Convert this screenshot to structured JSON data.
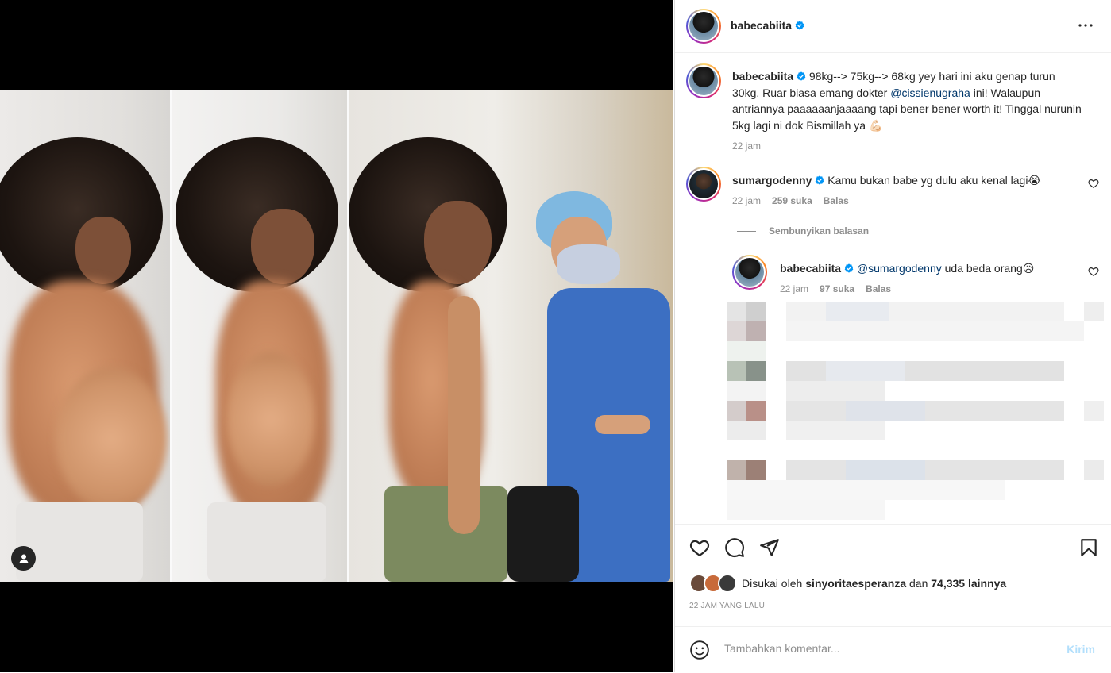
{
  "post": {
    "author": "babecabiita",
    "caption_text": "98kg--> 75kg--> 68kg yey hari ini aku genap turun 30kg. Ruar biasa emang dokter ",
    "caption_mention": "@cissienugraha",
    "caption_end": " ini! Walaupun antriannya paaaaaanjaaaang tapi bener bener worth it! Tinggal nurunin 5kg lagi ni dok Bismillah ya 💪🏻",
    "caption_time": "22 jam"
  },
  "comments": [
    {
      "user": "sumargodenny",
      "text": "Kamu bukan babe yg dulu aku kenal lagi😭",
      "time": "22 jam",
      "likes": "259 suka",
      "reply_label": "Balas"
    }
  ],
  "hide_replies_label": "Sembunyikan balasan",
  "reply": {
    "user": "babecabiita",
    "mention": "@sumargodenny",
    "text": " uda beda orang😥",
    "time": "22 jam",
    "likes": "97 suka",
    "reply_label": "Balas"
  },
  "likes": {
    "prefix": "Disukai oleh ",
    "user": "sinyoritaesperanza",
    "middle": " dan ",
    "count": "74,335 lainnya"
  },
  "posted_time": "22 JAM YANG LALU",
  "comment_box": {
    "placeholder": "Tambahkan komentar...",
    "send_label": "Kirim"
  },
  "colors": {
    "verified": "#0095f6",
    "mention": "#00376b",
    "send_disabled": "#b2dffc"
  },
  "icons": [
    "more-options-icon",
    "heart-icon",
    "comment-icon",
    "share-icon",
    "bookmark-icon",
    "emoji-icon",
    "tagged-user-icon",
    "verified-badge-icon"
  ]
}
